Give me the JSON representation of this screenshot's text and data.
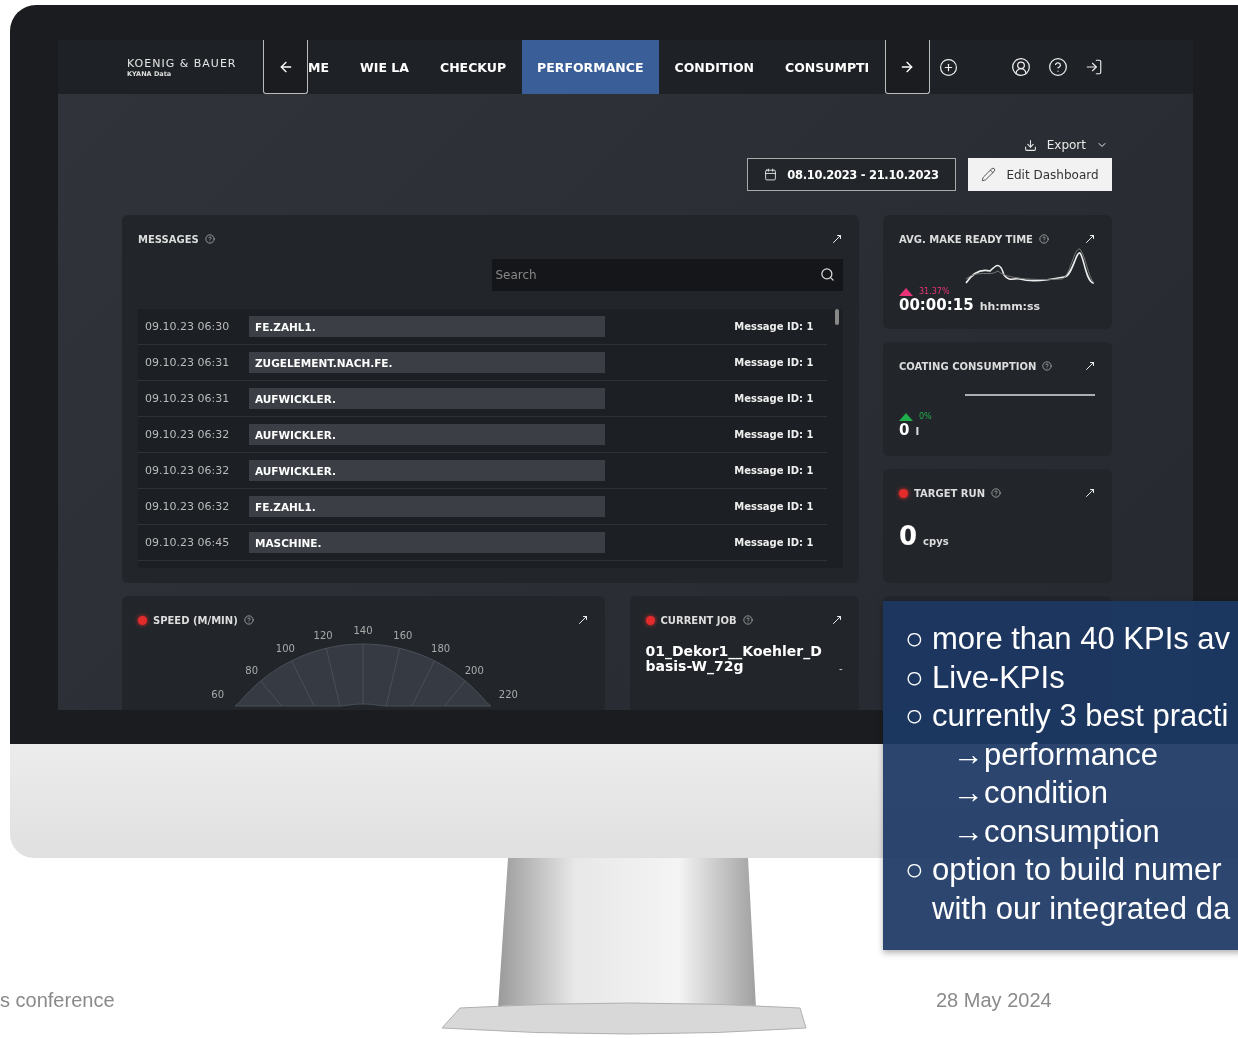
{
  "app": {
    "logo": {
      "name": "KOENIG & BAUER",
      "product": "KYANA Data"
    },
    "tabs": [
      {
        "label": "ME",
        "selected": false
      },
      {
        "label": "WIE LA",
        "selected": false
      },
      {
        "label": "CHECKUP",
        "selected": false
      },
      {
        "label": "PERFORMANCE",
        "selected": true
      },
      {
        "label": "CONDITION",
        "selected": false
      },
      {
        "label": "CONSUMPTI",
        "selected": false
      }
    ],
    "export": {
      "label": "Export"
    },
    "date_range": "08.10.2023 - 21.10.2023",
    "edit_button": "Edit Dashboard",
    "messages": {
      "title": "MESSAGES",
      "search": {
        "placeholder": "Search"
      },
      "rows": [
        {
          "time": "09.10.23 06:30",
          "message": "FE.ZAHL1.",
          "id": "Message ID: 1"
        },
        {
          "time": "09.10.23 06:31",
          "message": "ZUGELEMENT.NACH.FE.",
          "id": "Message ID: 1"
        },
        {
          "time": "09.10.23 06:31",
          "message": "AUFWICKLER.",
          "id": "Message ID: 1"
        },
        {
          "time": "09.10.23 06:32",
          "message": "AUFWICKLER.",
          "id": "Message ID: 1"
        },
        {
          "time": "09.10.23 06:32",
          "message": "AUFWICKLER.",
          "id": "Message ID: 1"
        },
        {
          "time": "09.10.23 06:32",
          "message": "FE.ZAHL1.",
          "id": "Message ID: 1"
        },
        {
          "time": "09.10.23 06:45",
          "message": "MASCHINE.",
          "id": "Message ID: 1"
        }
      ]
    },
    "kpis": [
      {
        "kind": "sparkline",
        "title": "AVG. MAKE READY TIME",
        "live": false,
        "trend": {
          "text": "31.37%",
          "color": "#e8337a"
        },
        "value": "00:00:15",
        "unit": "hh:mm:ss"
      },
      {
        "kind": "flatline",
        "title": "COATING CONSUMPTION",
        "live": false,
        "trend": {
          "text": "0%",
          "color": "#1fae4b"
        },
        "value": "0",
        "unit": "l"
      },
      {
        "kind": "plain",
        "title": "TARGET RUN",
        "live": true,
        "value": "0",
        "unit": "cpys"
      }
    ],
    "speed": {
      "title": "SPEED (M/MIN)",
      "live": true,
      "ticks": [
        "60",
        "80",
        "100",
        "120",
        "140",
        "160",
        "180",
        "200",
        "220"
      ]
    },
    "current_job": {
      "title": "CURRENT JOB",
      "live": true,
      "lines": [
        "01_Dekor1__Koehler_D",
        "basis-W_72g"
      ],
      "side": "-"
    }
  },
  "overlay": {
    "items": [
      {
        "kind": "main",
        "marker": "○",
        "lines": [
          "more than 40 KPIs av"
        ]
      },
      {
        "kind": "main",
        "marker": "○",
        "lines": [
          "Live-KPIs"
        ]
      },
      {
        "kind": "main",
        "marker": "○",
        "lines": [
          "currently 3 best practi"
        ]
      },
      {
        "kind": "sub",
        "marker": "→",
        "lines": [
          "performance"
        ]
      },
      {
        "kind": "sub",
        "marker": "→",
        "lines": [
          "condition"
        ]
      },
      {
        "kind": "sub",
        "marker": "→",
        "lines": [
          "consumption"
        ]
      },
      {
        "kind": "main",
        "marker": "○",
        "lines": [
          "option to build numer",
          "with our integrated da"
        ]
      }
    ]
  },
  "footer": {
    "left": "s conference",
    "date": "28 May 2024"
  }
}
